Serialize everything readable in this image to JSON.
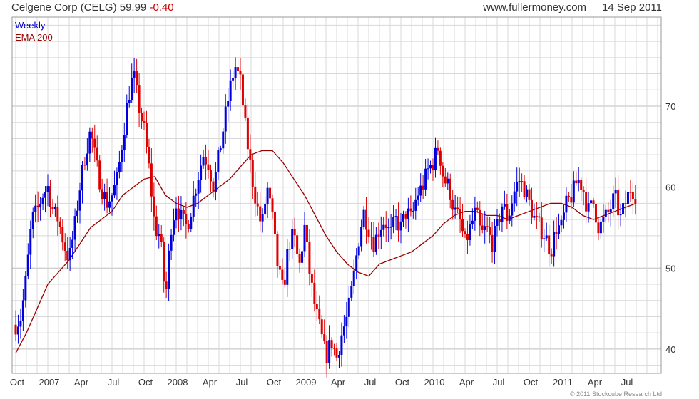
{
  "header": {
    "title": "Celgene Corp (CELG)",
    "price": "59.99",
    "change": "-0.40",
    "site": "www.fullermoney.com",
    "date": "14 Sep 2011"
  },
  "legend": {
    "weekly": "Weekly",
    "ema": "EMA 200"
  },
  "footer": {
    "copyright": "© 2011 Stockcube Research Ltd"
  },
  "colors": {
    "up": "#0000dd",
    "down": "#dd0000",
    "ema": "#990000",
    "grid": "#d8d8d8"
  },
  "chart_data": {
    "type": "ohlc",
    "title": "Celgene Corp (CELG) 59.99 -0.40",
    "interval": "Weekly",
    "ylim": [
      37,
      81
    ],
    "y_ticks": [
      40,
      50,
      60,
      70
    ],
    "x_labels": [
      "Oct",
      "2007",
      "Apr",
      "Jul",
      "Oct",
      "2008",
      "Apr",
      "Jul",
      "Oct",
      "2009",
      "Apr",
      "Jul",
      "Oct",
      "2010",
      "Apr",
      "Jul",
      "Oct",
      "2011",
      "Apr",
      "Jul"
    ],
    "x_label_month_index": [
      0,
      3,
      6,
      9,
      12,
      15,
      18,
      21,
      24,
      27,
      30,
      33,
      36,
      39,
      42,
      45,
      48,
      51,
      54,
      57
    ],
    "months_total": 60,
    "series": [
      {
        "name": "Weekly",
        "points": [
          [
            0,
            43
          ],
          [
            0.5,
            44
          ],
          [
            1,
            49
          ],
          [
            1.5,
            56
          ],
          [
            2,
            57
          ],
          [
            2.5,
            59
          ],
          [
            3,
            60
          ],
          [
            3.5,
            57
          ],
          [
            4,
            56
          ],
          [
            4.5,
            53
          ],
          [
            5,
            51
          ],
          [
            5.5,
            55
          ],
          [
            6,
            60
          ],
          [
            6.5,
            64
          ],
          [
            7,
            67
          ],
          [
            7.5,
            63
          ],
          [
            8,
            60
          ],
          [
            8.5,
            58
          ],
          [
            9,
            59
          ],
          [
            9.5,
            61
          ],
          [
            10,
            66
          ],
          [
            10.5,
            71
          ],
          [
            11,
            74
          ],
          [
            11.5,
            70
          ],
          [
            12,
            67
          ],
          [
            12.5,
            62
          ],
          [
            13,
            55
          ],
          [
            13.5,
            54
          ],
          [
            14,
            46
          ],
          [
            14.5,
            55
          ],
          [
            15,
            58
          ],
          [
            15.5,
            56
          ],
          [
            16,
            55
          ],
          [
            16.5,
            58
          ],
          [
            17,
            61
          ],
          [
            17.5,
            64
          ],
          [
            18,
            63
          ],
          [
            18.5,
            60
          ],
          [
            19,
            64
          ],
          [
            19.5,
            68
          ],
          [
            20,
            72
          ],
          [
            20.5,
            75
          ],
          [
            21,
            73
          ],
          [
            21.5,
            67
          ],
          [
            22,
            62
          ],
          [
            22.5,
            58
          ],
          [
            23,
            55
          ],
          [
            23.5,
            60
          ],
          [
            24,
            56
          ],
          [
            24.5,
            50
          ],
          [
            25,
            47
          ],
          [
            25.5,
            53
          ],
          [
            26,
            54
          ],
          [
            26.5,
            50
          ],
          [
            27,
            55
          ],
          [
            27.5,
            49
          ],
          [
            28,
            45
          ],
          [
            28.5,
            42
          ],
          [
            29,
            39
          ],
          [
            29.5,
            41
          ],
          [
            30,
            39
          ],
          [
            30.5,
            42
          ],
          [
            31,
            44
          ],
          [
            31.5,
            48
          ],
          [
            32,
            53
          ],
          [
            32.5,
            57
          ],
          [
            33,
            55
          ],
          [
            33.5,
            53
          ],
          [
            34,
            55
          ],
          [
            34.5,
            56
          ],
          [
            35,
            54
          ],
          [
            35.5,
            56
          ],
          [
            36,
            55
          ],
          [
            36.5,
            57
          ],
          [
            37,
            56
          ],
          [
            37.5,
            59
          ],
          [
            38,
            60
          ],
          [
            38.5,
            62
          ],
          [
            39,
            63
          ],
          [
            39.5,
            65
          ],
          [
            40,
            61
          ],
          [
            40.5,
            60
          ],
          [
            41,
            57
          ],
          [
            41.5,
            56
          ],
          [
            42,
            53
          ],
          [
            42.5,
            55
          ],
          [
            43,
            57
          ],
          [
            43.5,
            54
          ],
          [
            44,
            55
          ],
          [
            44.5,
            53
          ],
          [
            45,
            55
          ],
          [
            45.5,
            58
          ],
          [
            46,
            56
          ],
          [
            46.5,
            59
          ],
          [
            47,
            61
          ],
          [
            47.5,
            60
          ],
          [
            48,
            58
          ],
          [
            48.5,
            56
          ],
          [
            49,
            55
          ],
          [
            49.5,
            54
          ],
          [
            50,
            52
          ],
          [
            50.5,
            55
          ],
          [
            51,
            55
          ],
          [
            51.5,
            58
          ],
          [
            52,
            59
          ],
          [
            52.5,
            61
          ],
          [
            53,
            60
          ],
          [
            53.5,
            57
          ],
          [
            54,
            58
          ],
          [
            54.5,
            55
          ],
          [
            55,
            56
          ],
          [
            55.5,
            57
          ],
          [
            56,
            59
          ],
          [
            56.5,
            56
          ],
          [
            57,
            58
          ],
          [
            57.5,
            60
          ],
          [
            58,
            59
          ]
        ]
      },
      {
        "name": "EMA 200",
        "points": [
          [
            0,
            39.5
          ],
          [
            1,
            42
          ],
          [
            2,
            45
          ],
          [
            3,
            48
          ],
          [
            4,
            49.5
          ],
          [
            5,
            51
          ],
          [
            6,
            53
          ],
          [
            7,
            55
          ],
          [
            8,
            56
          ],
          [
            9,
            57
          ],
          [
            10,
            59
          ],
          [
            11,
            60
          ],
          [
            12,
            61
          ],
          [
            13,
            61.3
          ],
          [
            14,
            59
          ],
          [
            15,
            58
          ],
          [
            16,
            57.5
          ],
          [
            17,
            58
          ],
          [
            18,
            59
          ],
          [
            19,
            60
          ],
          [
            20,
            61
          ],
          [
            21,
            62.5
          ],
          [
            22,
            64
          ],
          [
            23,
            64.5
          ],
          [
            24,
            64.5
          ],
          [
            25,
            63
          ],
          [
            26,
            61
          ],
          [
            27,
            59
          ],
          [
            28,
            56.5
          ],
          [
            29,
            54
          ],
          [
            30,
            52
          ],
          [
            31,
            50.5
          ],
          [
            32,
            49.5
          ],
          [
            33,
            49
          ],
          [
            34,
            50.5
          ],
          [
            35,
            51
          ],
          [
            36,
            51.5
          ],
          [
            37,
            52
          ],
          [
            38,
            53
          ],
          [
            39,
            54
          ],
          [
            40,
            55.5
          ],
          [
            41,
            56.5
          ],
          [
            42,
            57
          ],
          [
            43,
            57
          ],
          [
            44,
            56.5
          ],
          [
            45,
            56.5
          ],
          [
            46,
            56
          ],
          [
            47,
            56.5
          ],
          [
            48,
            57
          ],
          [
            49,
            57.5
          ],
          [
            50,
            58
          ],
          [
            51,
            58
          ],
          [
            52,
            57.5
          ],
          [
            53,
            56.5
          ],
          [
            54,
            56
          ],
          [
            55,
            56.5
          ],
          [
            56,
            57
          ],
          [
            57,
            57.5
          ],
          [
            58,
            58
          ]
        ]
      }
    ],
    "grid": true
  }
}
